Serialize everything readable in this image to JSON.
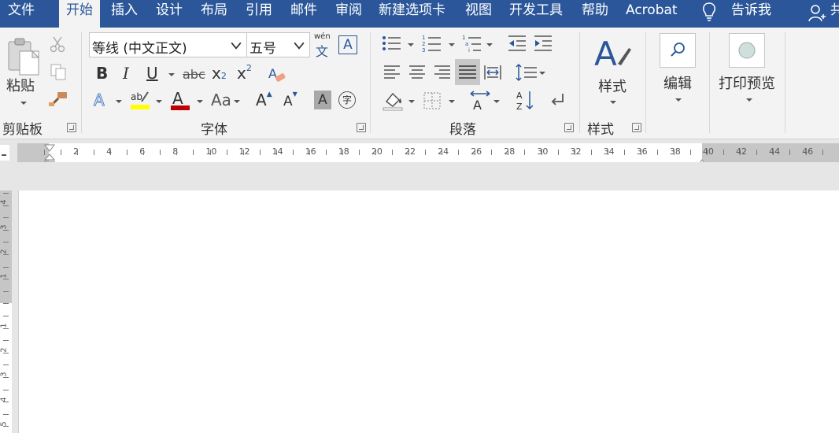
{
  "tabs": [
    {
      "label": "文件",
      "active": false
    },
    {
      "label": "开始",
      "active": true
    },
    {
      "label": "插入",
      "active": false
    },
    {
      "label": "设计",
      "active": false
    },
    {
      "label": "布局",
      "active": false
    },
    {
      "label": "引用",
      "active": false
    },
    {
      "label": "邮件",
      "active": false
    },
    {
      "label": "审阅",
      "active": false
    },
    {
      "label": "新建选项卡",
      "active": false
    },
    {
      "label": "视图",
      "active": false
    },
    {
      "label": "开发工具",
      "active": false
    },
    {
      "label": "帮助",
      "active": false
    },
    {
      "label": "Acrobat",
      "active": false
    },
    {
      "label": "告诉我",
      "active": false
    },
    {
      "label": "共",
      "active": false
    }
  ],
  "clipboard": {
    "paste_label": "粘贴",
    "group_label": "剪贴板"
  },
  "font": {
    "name": "等线 (中文正文)",
    "size": "五号",
    "group_label": "字体",
    "phonetic_top": "wén",
    "phonetic_bottom": "文",
    "border_char": "A",
    "bold": "B",
    "italic": "I",
    "underline": "U",
    "strike": "abc",
    "sub": "x",
    "sub_small": "2",
    "sup": "x",
    "sup_small": "2",
    "grow": "A",
    "shrink": "A",
    "aa": "Aa",
    "shade": "A",
    "enclose": "字"
  },
  "paragraph": {
    "group_label": "段落"
  },
  "styles": {
    "label": "样式",
    "group_label": "样式"
  },
  "editing": {
    "label": "编辑"
  },
  "print_preview": {
    "label": "打印预览"
  },
  "hruler_numbers": [
    "2",
    "4",
    "6",
    "8",
    "10",
    "12",
    "14",
    "16",
    "18",
    "20",
    "22",
    "24",
    "26",
    "28",
    "30",
    "32",
    "34",
    "36",
    "38",
    "40",
    "42",
    "44",
    "46"
  ],
  "vruler_numbers": [
    "4",
    "3",
    "2",
    "1",
    "1",
    "2",
    "3",
    "4",
    "5"
  ],
  "colors": {
    "accent": "#2b579a",
    "highlight": "#ffff00",
    "font_color": "#c00000"
  }
}
